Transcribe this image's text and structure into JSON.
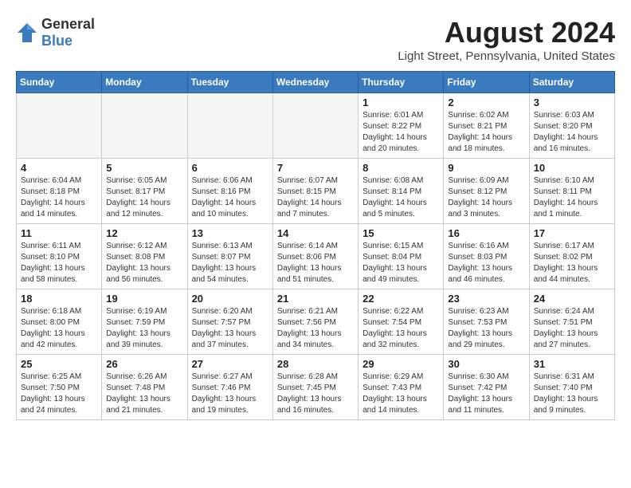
{
  "logo": {
    "general": "General",
    "blue": "Blue"
  },
  "title": {
    "month_year": "August 2024",
    "location": "Light Street, Pennsylvania, United States"
  },
  "days_of_week": [
    "Sunday",
    "Monday",
    "Tuesday",
    "Wednesday",
    "Thursday",
    "Friday",
    "Saturday"
  ],
  "weeks": [
    [
      {
        "day": "",
        "info": ""
      },
      {
        "day": "",
        "info": ""
      },
      {
        "day": "",
        "info": ""
      },
      {
        "day": "",
        "info": ""
      },
      {
        "day": "1",
        "info": "Sunrise: 6:01 AM\nSunset: 8:22 PM\nDaylight: 14 hours\nand 20 minutes."
      },
      {
        "day": "2",
        "info": "Sunrise: 6:02 AM\nSunset: 8:21 PM\nDaylight: 14 hours\nand 18 minutes."
      },
      {
        "day": "3",
        "info": "Sunrise: 6:03 AM\nSunset: 8:20 PM\nDaylight: 14 hours\nand 16 minutes."
      }
    ],
    [
      {
        "day": "4",
        "info": "Sunrise: 6:04 AM\nSunset: 8:18 PM\nDaylight: 14 hours\nand 14 minutes."
      },
      {
        "day": "5",
        "info": "Sunrise: 6:05 AM\nSunset: 8:17 PM\nDaylight: 14 hours\nand 12 minutes."
      },
      {
        "day": "6",
        "info": "Sunrise: 6:06 AM\nSunset: 8:16 PM\nDaylight: 14 hours\nand 10 minutes."
      },
      {
        "day": "7",
        "info": "Sunrise: 6:07 AM\nSunset: 8:15 PM\nDaylight: 14 hours\nand 7 minutes."
      },
      {
        "day": "8",
        "info": "Sunrise: 6:08 AM\nSunset: 8:14 PM\nDaylight: 14 hours\nand 5 minutes."
      },
      {
        "day": "9",
        "info": "Sunrise: 6:09 AM\nSunset: 8:12 PM\nDaylight: 14 hours\nand 3 minutes."
      },
      {
        "day": "10",
        "info": "Sunrise: 6:10 AM\nSunset: 8:11 PM\nDaylight: 14 hours\nand 1 minute."
      }
    ],
    [
      {
        "day": "11",
        "info": "Sunrise: 6:11 AM\nSunset: 8:10 PM\nDaylight: 13 hours\nand 58 minutes."
      },
      {
        "day": "12",
        "info": "Sunrise: 6:12 AM\nSunset: 8:08 PM\nDaylight: 13 hours\nand 56 minutes."
      },
      {
        "day": "13",
        "info": "Sunrise: 6:13 AM\nSunset: 8:07 PM\nDaylight: 13 hours\nand 54 minutes."
      },
      {
        "day": "14",
        "info": "Sunrise: 6:14 AM\nSunset: 8:06 PM\nDaylight: 13 hours\nand 51 minutes."
      },
      {
        "day": "15",
        "info": "Sunrise: 6:15 AM\nSunset: 8:04 PM\nDaylight: 13 hours\nand 49 minutes."
      },
      {
        "day": "16",
        "info": "Sunrise: 6:16 AM\nSunset: 8:03 PM\nDaylight: 13 hours\nand 46 minutes."
      },
      {
        "day": "17",
        "info": "Sunrise: 6:17 AM\nSunset: 8:02 PM\nDaylight: 13 hours\nand 44 minutes."
      }
    ],
    [
      {
        "day": "18",
        "info": "Sunrise: 6:18 AM\nSunset: 8:00 PM\nDaylight: 13 hours\nand 42 minutes."
      },
      {
        "day": "19",
        "info": "Sunrise: 6:19 AM\nSunset: 7:59 PM\nDaylight: 13 hours\nand 39 minutes."
      },
      {
        "day": "20",
        "info": "Sunrise: 6:20 AM\nSunset: 7:57 PM\nDaylight: 13 hours\nand 37 minutes."
      },
      {
        "day": "21",
        "info": "Sunrise: 6:21 AM\nSunset: 7:56 PM\nDaylight: 13 hours\nand 34 minutes."
      },
      {
        "day": "22",
        "info": "Sunrise: 6:22 AM\nSunset: 7:54 PM\nDaylight: 13 hours\nand 32 minutes."
      },
      {
        "day": "23",
        "info": "Sunrise: 6:23 AM\nSunset: 7:53 PM\nDaylight: 13 hours\nand 29 minutes."
      },
      {
        "day": "24",
        "info": "Sunrise: 6:24 AM\nSunset: 7:51 PM\nDaylight: 13 hours\nand 27 minutes."
      }
    ],
    [
      {
        "day": "25",
        "info": "Sunrise: 6:25 AM\nSunset: 7:50 PM\nDaylight: 13 hours\nand 24 minutes."
      },
      {
        "day": "26",
        "info": "Sunrise: 6:26 AM\nSunset: 7:48 PM\nDaylight: 13 hours\nand 21 minutes."
      },
      {
        "day": "27",
        "info": "Sunrise: 6:27 AM\nSunset: 7:46 PM\nDaylight: 13 hours\nand 19 minutes."
      },
      {
        "day": "28",
        "info": "Sunrise: 6:28 AM\nSunset: 7:45 PM\nDaylight: 13 hours\nand 16 minutes."
      },
      {
        "day": "29",
        "info": "Sunrise: 6:29 AM\nSunset: 7:43 PM\nDaylight: 13 hours\nand 14 minutes."
      },
      {
        "day": "30",
        "info": "Sunrise: 6:30 AM\nSunset: 7:42 PM\nDaylight: 13 hours\nand 11 minutes."
      },
      {
        "day": "31",
        "info": "Sunrise: 6:31 AM\nSunset: 7:40 PM\nDaylight: 13 hours\nand 9 minutes."
      }
    ]
  ]
}
